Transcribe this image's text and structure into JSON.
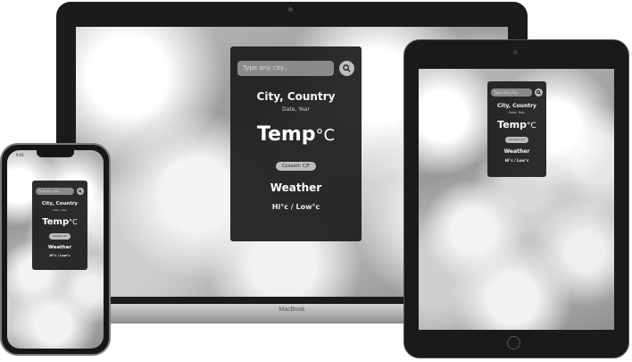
{
  "laptop": {
    "brand": "MacBook",
    "app": {
      "search": {
        "placeholder": "Type any city..."
      },
      "city": "City, Country",
      "date": "Date, Year",
      "temp": "Temp",
      "temp_unit": "°C",
      "convert_label": "Convert: C/F",
      "weather": "Weather",
      "hilo": "Hi°c / Low°c"
    }
  },
  "tablet": {
    "app": {
      "search": {
        "placeholder": "Type any city..."
      },
      "city": "City, Country",
      "date": "Date, Year",
      "temp": "Temp",
      "temp_unit": "°C",
      "convert_label": "Convert: C/F",
      "weather": "Weather",
      "hilo": "Hi°c / Low°c"
    }
  },
  "phone": {
    "status_time": "9:41",
    "app": {
      "search": {
        "placeholder": "Type any city..."
      },
      "city": "City, Country",
      "date": "Date, Year",
      "temp": "Temp",
      "temp_unit": "°C",
      "convert_label": "Convert: C/F",
      "weather": "Weather",
      "hilo": "Hi°c / Low°c"
    }
  }
}
